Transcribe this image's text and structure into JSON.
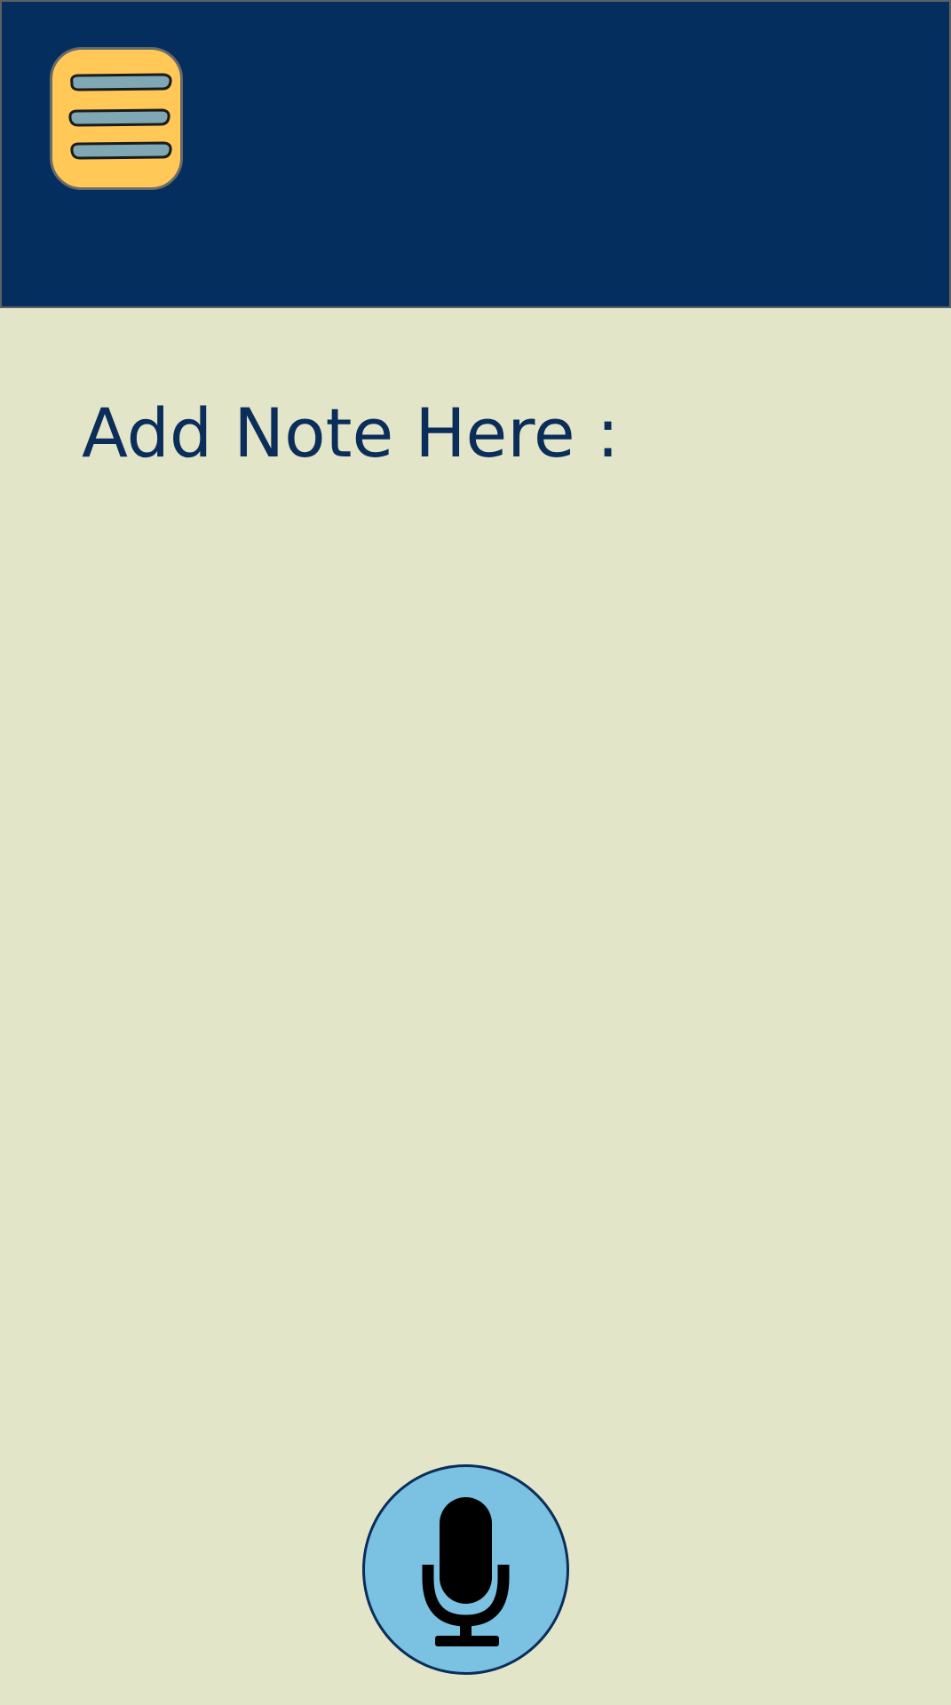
{
  "header": {
    "background": "#042e5e",
    "menu_button": {
      "icon": "hamburger-menu-icon",
      "background": "#ffc857",
      "bar_color": "#7fa8b4"
    }
  },
  "main": {
    "background": "#e3e5c9",
    "note_label": "Add Note Here :",
    "note_label_color": "#0b2d5a",
    "note_value": ""
  },
  "mic_button": {
    "icon": "microphone-icon",
    "background": "#7bc1e2",
    "border": "#0b2d5a"
  }
}
